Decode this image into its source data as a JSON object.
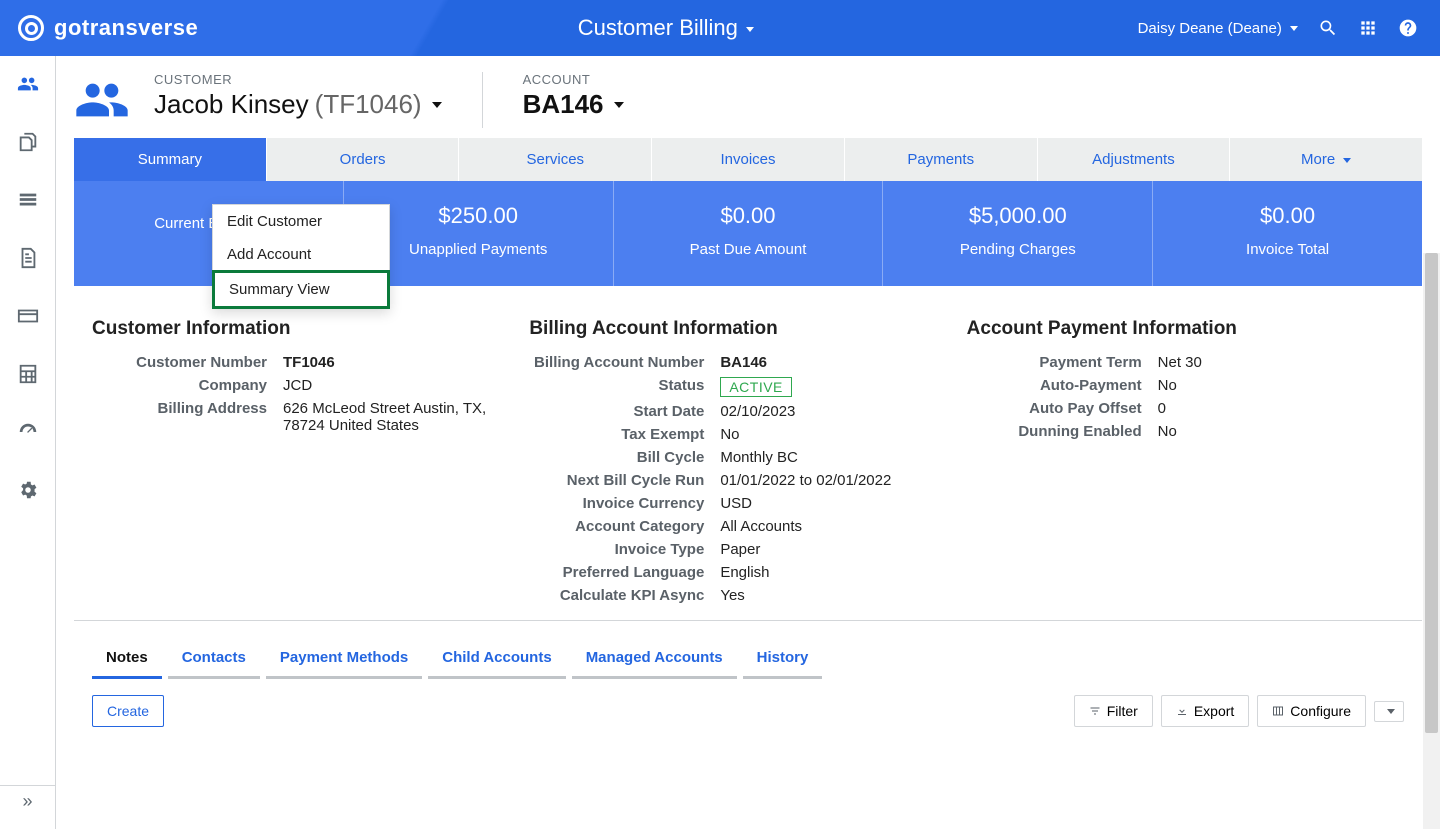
{
  "top": {
    "brand": "gotransverse",
    "title": "Customer Billing",
    "user": "Daisy Deane (Deane)"
  },
  "header": {
    "customerLabel": "CUSTOMER",
    "customerName": "Jacob Kinsey",
    "customerNum": "(TF1046)",
    "accountLabel": "ACCOUNT",
    "accountNum": "BA146"
  },
  "custMenu": {
    "edit": "Edit Customer",
    "add": "Add Account",
    "summary": "Summary View"
  },
  "tabs": {
    "summary": "Summary",
    "orders": "Orders",
    "services": "Services",
    "invoices": "Invoices",
    "payments": "Payments",
    "adjustments": "Adjustments",
    "more": "More"
  },
  "metrics": {
    "balance": {
      "value": "",
      "label": "Current Balance"
    },
    "unapplied": {
      "value": "$250.00",
      "label": "Unapplied Payments"
    },
    "pastdue": {
      "value": "$0.00",
      "label": "Past Due Amount"
    },
    "pending": {
      "value": "$5,000.00",
      "label": "Pending Charges"
    },
    "invoice": {
      "value": "$0.00",
      "label": "Invoice Total"
    }
  },
  "custInfo": {
    "title": "Customer Information",
    "number": {
      "k": "Customer Number",
      "v": "TF1046"
    },
    "company": {
      "k": "Company",
      "v": "JCD"
    },
    "address": {
      "k": "Billing Address",
      "v": "626 McLeod Street Austin, TX, 78724 United States"
    }
  },
  "baInfo": {
    "title": "Billing Account Information",
    "number": {
      "k": "Billing Account Number",
      "v": "BA146"
    },
    "status": {
      "k": "Status",
      "v": "ACTIVE"
    },
    "start": {
      "k": "Start Date",
      "v": "02/10/2023"
    },
    "tax": {
      "k": "Tax Exempt",
      "v": "No"
    },
    "cycle": {
      "k": "Bill Cycle",
      "v": "Monthly BC"
    },
    "next": {
      "k": "Next Bill Cycle Run",
      "v": "01/01/2022 to 02/01/2022"
    },
    "currency": {
      "k": "Invoice Currency",
      "v": "USD"
    },
    "category": {
      "k": "Account Category",
      "v": "All Accounts"
    },
    "invoiceType": {
      "k": "Invoice Type",
      "v": "Paper"
    },
    "lang": {
      "k": "Preferred Language",
      "v": "English"
    },
    "kpi": {
      "k": "Calculate KPI Async",
      "v": "Yes"
    }
  },
  "payInfo": {
    "title": "Account Payment Information",
    "term": {
      "k": "Payment Term",
      "v": "Net 30"
    },
    "auto": {
      "k": "Auto-Payment",
      "v": "No"
    },
    "offset": {
      "k": "Auto Pay Offset",
      "v": "0"
    },
    "dunning": {
      "k": "Dunning Enabled",
      "v": "No"
    }
  },
  "subtabs": {
    "notes": "Notes",
    "contacts": "Contacts",
    "paymethods": "Payment Methods",
    "child": "Child Accounts",
    "managed": "Managed Accounts",
    "history": "History"
  },
  "toolbar": {
    "create": "Create",
    "filter": "Filter",
    "export": "Export",
    "configure": "Configure"
  }
}
